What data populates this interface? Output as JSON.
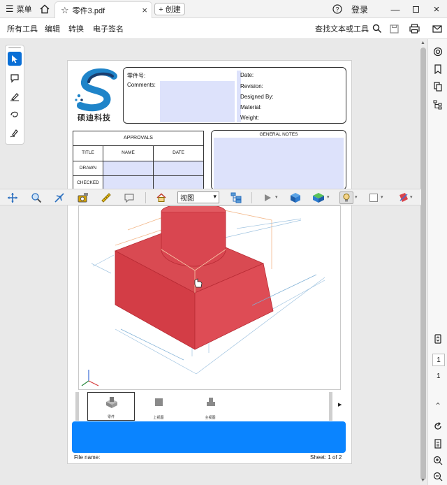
{
  "titlebar": {
    "menu_label": "菜单",
    "tab_title": "零件3.pdf",
    "new_label": "+ 创建",
    "signin": "登录"
  },
  "menubar": {
    "items": [
      "所有工具",
      "编辑",
      "转换",
      "电子签名"
    ],
    "find": "查找文本或工具"
  },
  "titleblock": {
    "logo_text": "硕迪科技",
    "part_no_label": "零件号:",
    "comments_label": "Comments:",
    "date_label": "Date:",
    "revision_label": "Revision:",
    "designed_by_label": "Designed By:",
    "material_label": "Material:",
    "weight_label": "Weight:"
  },
  "approvals": {
    "header": "APPROVALS",
    "columns": [
      "TITLE",
      "NAME",
      "DATE"
    ],
    "rows": [
      "DRAWN",
      "CHECKED"
    ]
  },
  "general_notes": {
    "header": "GENERAL NOTES"
  },
  "viewer": {
    "view_select": "视图",
    "thumbnails": [
      "零件",
      "上视图",
      "主视图"
    ]
  },
  "footer": {
    "file_name": "File name:",
    "sheet": "Sheet: 1  of 2"
  },
  "page_nav": {
    "current": "1",
    "total": "1"
  },
  "colors": {
    "accent": "#0a84ff",
    "part": "#d9434a",
    "field": "#dde2fb"
  }
}
